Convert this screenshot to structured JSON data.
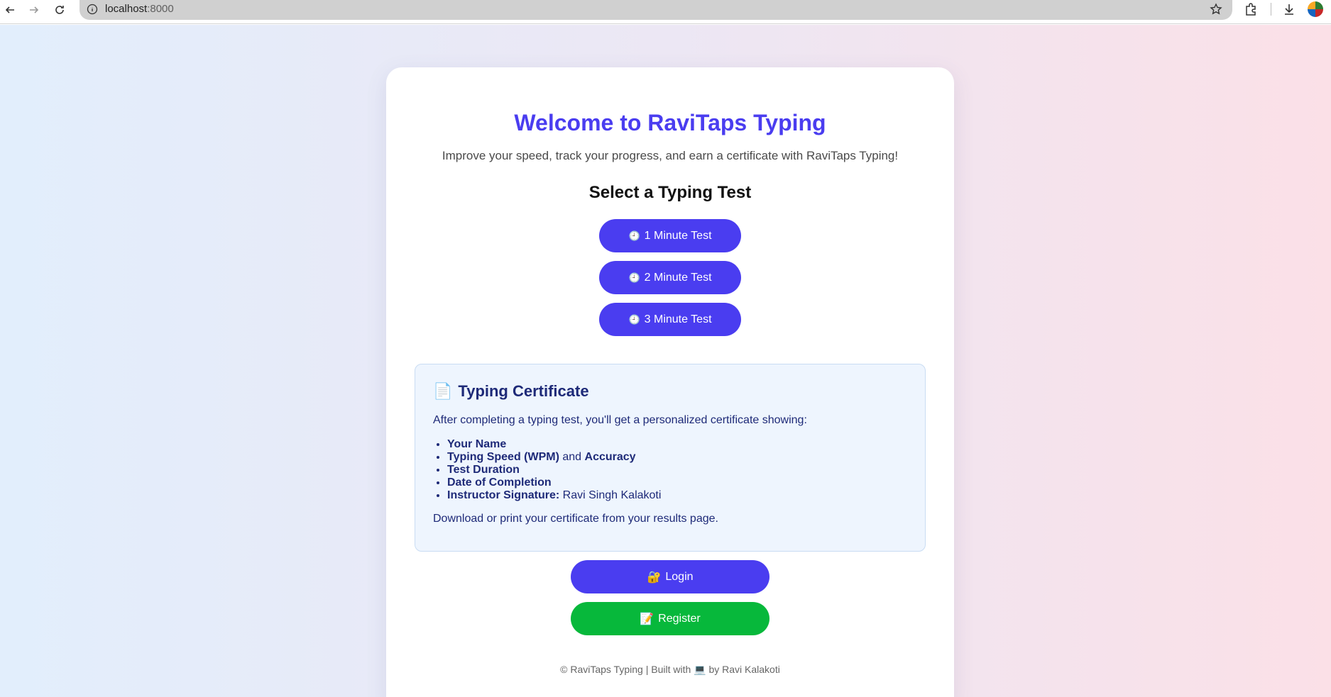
{
  "browser": {
    "url_host": "localhost",
    "url_port": ":8000",
    "icons": [
      "back-icon",
      "forward-icon",
      "reload-icon",
      "info-icon",
      "star-icon",
      "extensions-icon",
      "download-icon",
      "profile-avatar"
    ]
  },
  "hero": {
    "title": "Welcome to RaviTaps Typing",
    "subtitle": "Improve your speed, track your progress, and earn a certificate with RaviTaps Typing!"
  },
  "tests": {
    "heading": "Select a Typing Test",
    "clock_glyph": "🕘",
    "items": [
      {
        "label": "1 Minute Test"
      },
      {
        "label": "2 Minute Test"
      },
      {
        "label": "3 Minute Test"
      }
    ]
  },
  "certificate": {
    "icon_glyph": "📄",
    "heading": "Typing Certificate",
    "intro": "After completing a typing test, you'll get a personalized certificate showing:",
    "items": {
      "name": "Your Name",
      "speed": "Typing Speed (WPM)",
      "and": " and ",
      "accuracy": "Accuracy",
      "duration": "Test Duration",
      "date": "Date of Completion",
      "signature_label": "Instructor Signature:",
      "signature_value": " Ravi Singh Kalakoti"
    },
    "note": "Download or print your certificate from your results page."
  },
  "actions": {
    "login_glyph": "🔐",
    "login_label": "Login",
    "register_glyph": "📝",
    "register_label": "Register"
  },
  "footer": {
    "text": "© RaviTaps Typing | Built with 💻 by Ravi Kalakoti"
  },
  "colors": {
    "accent": "#4a3df0",
    "register": "#07b83b",
    "certificate_text": "#1e2a78",
    "certificate_bg": "#eef5fe"
  }
}
